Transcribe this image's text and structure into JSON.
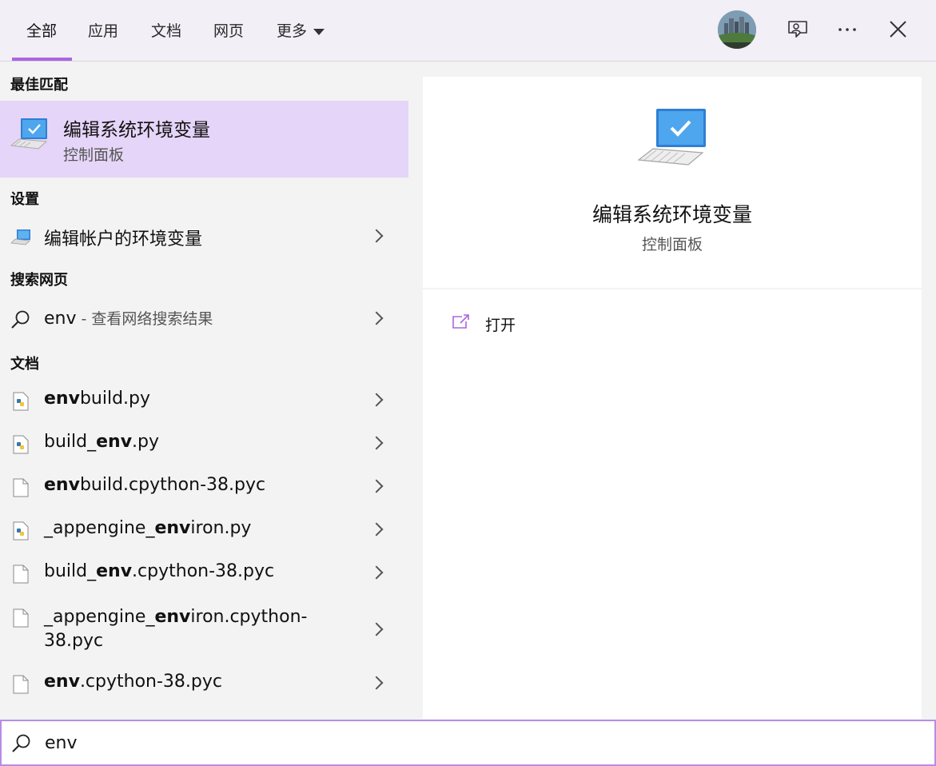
{
  "tabs": [
    {
      "label": "全部",
      "active": true
    },
    {
      "label": "应用",
      "active": false
    },
    {
      "label": "文档",
      "active": false
    },
    {
      "label": "网页",
      "active": false
    },
    {
      "label": "更多",
      "active": false
    }
  ],
  "accent_color": "#a866e0",
  "sections": {
    "best_match": "最佳匹配",
    "settings": "设置",
    "web": "搜索网页",
    "documents": "文档"
  },
  "best_match": {
    "title": "编辑系统环境变量",
    "subtitle": "控制面板",
    "icon": "monitor-check-icon"
  },
  "settings_items": [
    {
      "label": "编辑帐户的环境变量",
      "icon": "monitor-settings-icon"
    }
  ],
  "web_item": {
    "query": "env",
    "suffix": " - 查看网络搜索结果"
  },
  "documents": [
    {
      "pre": "",
      "match": "env",
      "post": "build.py",
      "icon": "python-file-icon"
    },
    {
      "pre": "build_",
      "match": "env",
      "post": ".py",
      "icon": "python-file-icon"
    },
    {
      "pre": "",
      "match": "env",
      "post": "build.cpython-38.pyc",
      "icon": "file-icon"
    },
    {
      "pre": "_appengine_",
      "match": "env",
      "post": "iron.py",
      "icon": "python-file-icon"
    },
    {
      "pre": "build_",
      "match": "env",
      "post": ".cpython-38.pyc",
      "icon": "file-icon"
    },
    {
      "pre": "_appengine_",
      "match": "env",
      "post": "iron.cpython-",
      "line2": "38.pyc",
      "icon": "file-icon"
    },
    {
      "pre": "",
      "match": "env",
      "post": ".cpython-38.pyc",
      "icon": "file-icon"
    }
  ],
  "preview": {
    "title": "编辑系统环境变量",
    "subtitle": "控制面板",
    "action_open": "打开"
  },
  "search": {
    "value": "env"
  }
}
